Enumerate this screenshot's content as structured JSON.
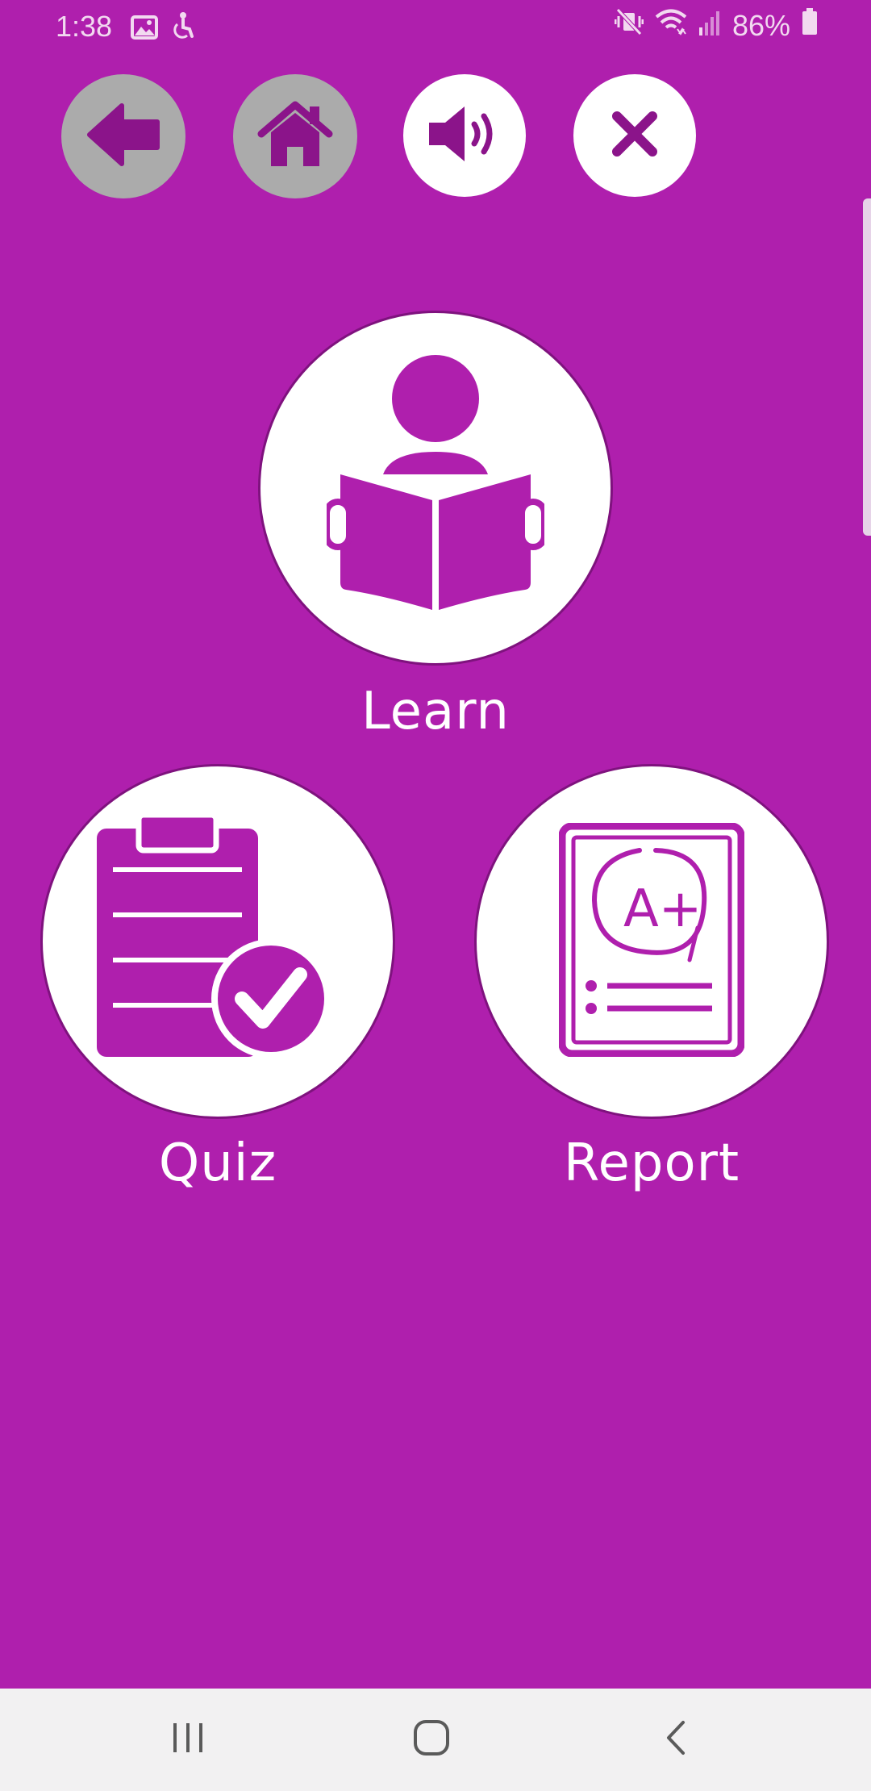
{
  "status_bar": {
    "time": "1:38",
    "battery": "86%",
    "icons": [
      "gallery-icon",
      "accessibility-icon",
      "mute-vibrate-icon",
      "wifi-icon",
      "signal-icon",
      "battery-icon"
    ]
  },
  "toolbar": {
    "buttons": [
      {
        "name": "back",
        "icon": "arrow-left-icon",
        "enabled": false
      },
      {
        "name": "home",
        "icon": "house-icon",
        "enabled": false
      },
      {
        "name": "sound",
        "icon": "speaker-icon",
        "enabled": true
      },
      {
        "name": "close",
        "icon": "close-icon",
        "enabled": true
      }
    ]
  },
  "menu": {
    "learn_label": "Learn",
    "quiz_label": "Quiz",
    "report_label": "Report",
    "report_grade": "A+"
  },
  "nav_bar": {
    "icons": [
      "recents-icon",
      "home-circle-icon",
      "back-chevron-icon"
    ]
  },
  "colors": {
    "background": "#af1fad",
    "accent": "#8b148a",
    "tile": "#ffffff",
    "disabled_button": "#ababab",
    "nav_bar": "#f2f1f2"
  }
}
